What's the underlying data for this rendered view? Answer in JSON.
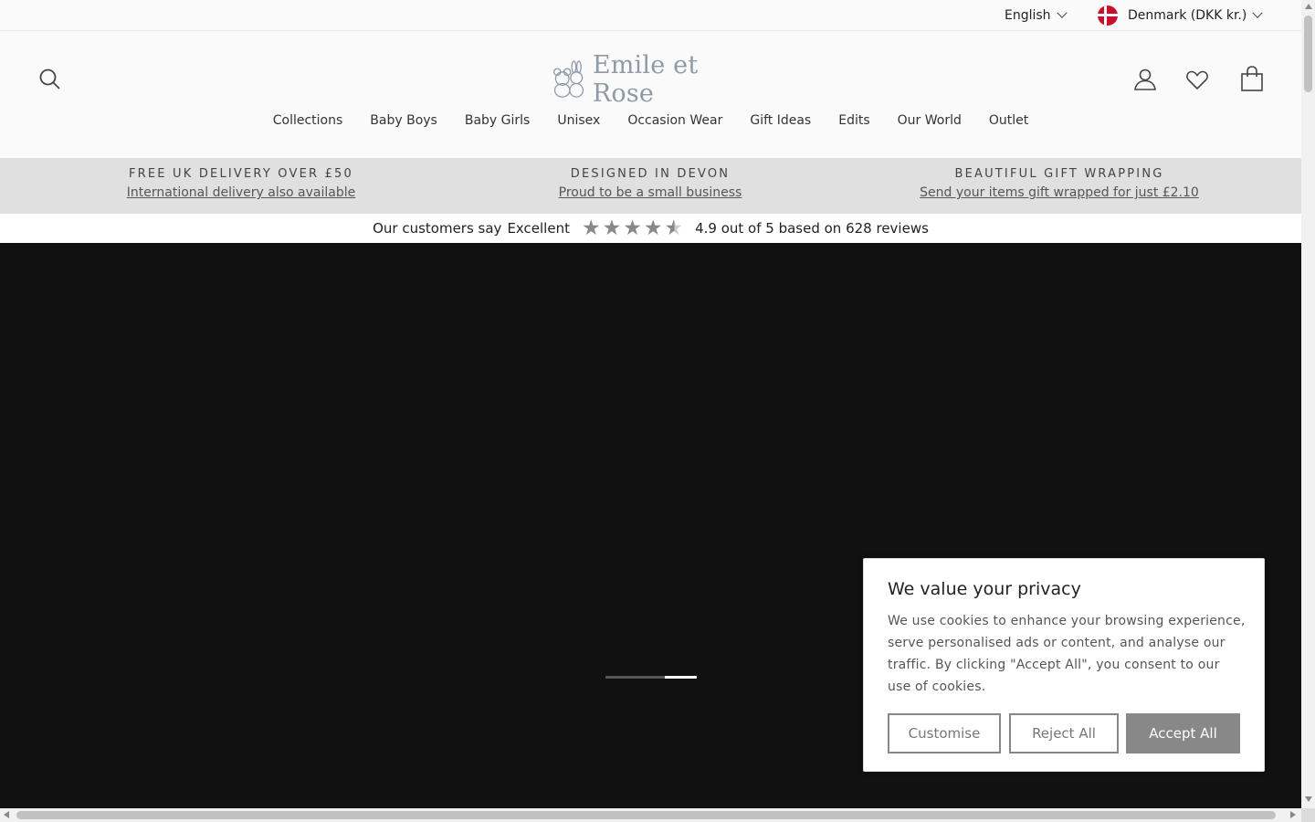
{
  "utility_bar": {
    "language": "English",
    "country": "Denmark (DKK kr.)"
  },
  "header": {
    "logo_text": "Emile et Rose",
    "icons": [
      "search-icon",
      "account-icon",
      "heart-icon",
      "bag-icon"
    ]
  },
  "nav": {
    "items": [
      "Collections",
      "Baby Boys",
      "Baby Girls",
      "Unisex",
      "Occasion Wear",
      "Gift Ideas",
      "Edits",
      "Our World",
      "Outlet"
    ]
  },
  "promo": [
    {
      "title": "FREE UK DELIVERY OVER £50",
      "link": "International delivery also available"
    },
    {
      "title": "DESIGNED IN DEVON",
      "link": "Proud to be a small business"
    },
    {
      "title": "BEAUTIFUL GIFT WRAPPING",
      "link": "Send your items gift wrapped for just £2.10"
    }
  ],
  "reviews": {
    "prefix": "Our customers say",
    "rating_word": "Excellent",
    "rating": 4.9,
    "summary": "4.9 out of 5 based on 628 reviews"
  },
  "hero": {
    "active_slide": 3,
    "slide_count": 3
  },
  "cookie": {
    "title": "We value your privacy",
    "text": "We use cookies to enhance your browsing experience, serve personalised ads or content, and analyse our traffic. By clicking \"Accept All\", you consent to our use of cookies.",
    "customise": "Customise",
    "reject": "Reject All",
    "accept": "Accept All"
  },
  "colors": {
    "logo": "#8e9aa6",
    "promo_bg": "#e0e0e0",
    "hero_bg": "#111111",
    "accept_bg": "#888888",
    "flag_red": "#c8102e"
  }
}
